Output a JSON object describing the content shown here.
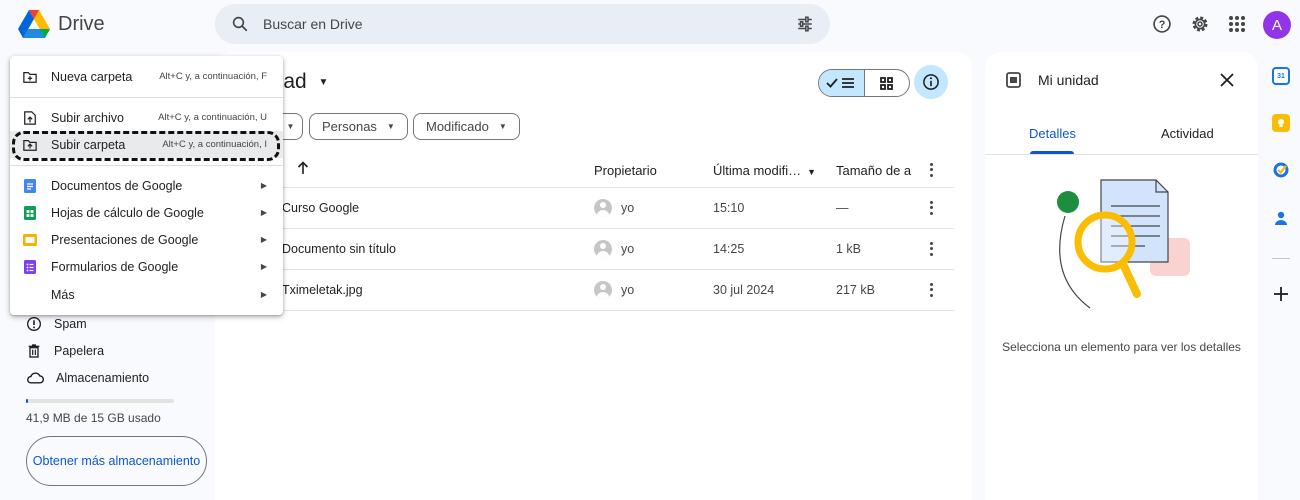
{
  "app": {
    "name": "Drive"
  },
  "search": {
    "placeholder": "Buscar en Drive"
  },
  "main": {
    "title": "idad",
    "filters": [
      "Personas",
      "Modificado"
    ],
    "columns": {
      "owner": "Propietario",
      "modified": "Última modifi…",
      "size": "Tamaño de a"
    },
    "rows": [
      {
        "name": "Curso Google",
        "owner": "yo",
        "modified": "15:10",
        "size": "—"
      },
      {
        "name": "Documento sin título",
        "owner": "yo",
        "modified": "14:25",
        "size": "1 kB"
      },
      {
        "name": "Tximeletak.jpg",
        "owner": "yo",
        "modified": "30 jul 2024",
        "size": "217 kB"
      }
    ]
  },
  "sidebar": {
    "items": [
      {
        "label": "Spam",
        "icon": "spam-icon"
      },
      {
        "label": "Papelera",
        "icon": "trash-icon"
      },
      {
        "label": "Almacenamiento",
        "icon": "cloud-icon"
      }
    ],
    "storage_text": "41,9 MB de 15 GB usado",
    "storage_button": "Obtener más almacenamiento",
    "storage_used_fraction": 0.0028
  },
  "menu": {
    "items": [
      {
        "label": "Nueva carpeta",
        "shortcut": "Alt+C y, a continuación, F",
        "icon": "new-folder-icon"
      },
      {
        "label": "Subir archivo",
        "shortcut": "Alt+C y, a continuación, U",
        "icon": "file-upload-icon"
      },
      {
        "label": "Subir carpeta",
        "shortcut": "Alt+C y, a continuación, I",
        "icon": "folder-upload-icon"
      },
      {
        "label": "Documentos de Google",
        "icon": "google-docs-icon",
        "color": "#4285f4"
      },
      {
        "label": "Hojas de cálculo de Google",
        "icon": "google-sheets-icon",
        "color": "#0f9d58"
      },
      {
        "label": "Presentaciones de Google",
        "icon": "google-slides-icon",
        "color": "#f4b400"
      },
      {
        "label": "Formularios de Google",
        "icon": "google-forms-icon",
        "color": "#7e3ff2"
      },
      {
        "label": "Más"
      }
    ]
  },
  "details": {
    "title": "Mi unidad",
    "tabs": [
      "Detalles",
      "Actividad"
    ],
    "hint": "Selecciona un elemento para ver los detalles"
  },
  "user": {
    "initial": "A",
    "avatar_color": "#9334e6"
  },
  "colors": {
    "accent": "#0b57d0",
    "selected": "#c2e7ff"
  }
}
